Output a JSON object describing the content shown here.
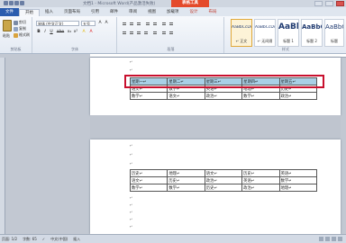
{
  "window": {
    "title": "文档1 - Microsoft Word(产品激活失败)",
    "context_tools": "表格工具"
  },
  "tabs": [
    {
      "label": "文件"
    },
    {
      "label": "开始"
    },
    {
      "label": "插入"
    },
    {
      "label": "页面布局"
    },
    {
      "label": "引用"
    },
    {
      "label": "邮件"
    },
    {
      "label": "审阅"
    },
    {
      "label": "视图"
    },
    {
      "label": "加载项"
    },
    {
      "label": "设计"
    },
    {
      "label": "布局"
    }
  ],
  "clipboard": {
    "paste": "粘贴",
    "cut": "剪切",
    "copy": "复制",
    "format_painter": "格式刷",
    "label": "剪贴板"
  },
  "font": {
    "name": "宋体 (中文正文)",
    "size": "五号",
    "label": "字体",
    "buttons": [
      "B",
      "I",
      "U",
      "abe",
      "x₂",
      "x²",
      "A",
      "A"
    ]
  },
  "paragraph": {
    "label": "段落"
  },
  "styles": {
    "label": "样式",
    "items": [
      {
        "preview": "AaBbCcDd",
        "name": "↵ 正文"
      },
      {
        "preview": "AaBbCcDd",
        "name": "↵ 无间隔"
      },
      {
        "preview": "AaBl",
        "name": "标题 1"
      },
      {
        "preview": "AaBbC",
        "name": "标题 2"
      },
      {
        "preview": "AaBbC",
        "name": "标题"
      }
    ]
  },
  "table1": {
    "header": [
      "星期一↵",
      "星期二↵",
      "星期三↵",
      "星期四↵",
      "星期五↵"
    ],
    "rows": [
      [
        "语文↵",
        "数学↵",
        "英语↵",
        "地理↵",
        "历史↵"
      ],
      [
        "数学↵",
        "语文↵",
        "政治↵",
        "数学↵",
        "政治↵"
      ]
    ]
  },
  "table2": {
    "rows": [
      [
        "历史↵",
        "地理↵",
        "语文↵",
        "历史↵",
        "英语↵"
      ],
      [
        "语文↵",
        "历史↵",
        "政治↵",
        "英语↵",
        "数学↵"
      ],
      [
        "数学↵",
        "数学↵",
        "历史↵",
        "政治↵",
        "地理↵"
      ]
    ]
  },
  "status": {
    "page": "页面: 1/2",
    "words": "字数: 65",
    "lang": "中文(中国)",
    "mode": "插入"
  },
  "colors": {
    "file_tab": "#2a5cae",
    "context_tab": "#e44a2a",
    "table_header": "#a8d0e6",
    "highlight_box": "#c8102e"
  }
}
